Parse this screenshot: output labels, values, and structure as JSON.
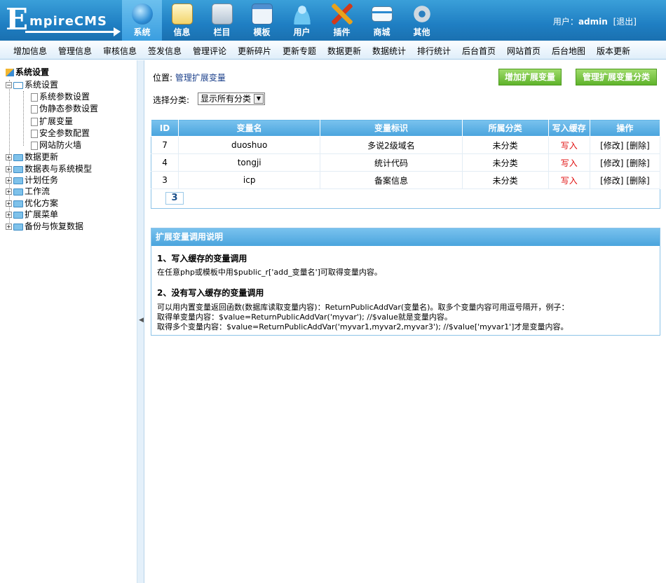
{
  "header": {
    "logo_letter": "E",
    "logo_rest": "mpireCMS",
    "nav": [
      {
        "label": "系统",
        "icon": "globe-icon"
      },
      {
        "label": "信息",
        "icon": "notepad-icon"
      },
      {
        "label": "栏目",
        "icon": "folder-icon"
      },
      {
        "label": "模板",
        "icon": "window-icon"
      },
      {
        "label": "用户",
        "icon": "user-icon"
      },
      {
        "label": "插件",
        "icon": "tools-icon"
      },
      {
        "label": "商城",
        "icon": "card-icon"
      },
      {
        "label": "其他",
        "icon": "gear-icon"
      }
    ],
    "user_label": "用户：",
    "user_name": "admin",
    "logout": "[退出]"
  },
  "menubar": [
    "增加信息",
    "管理信息",
    "审核信息",
    "签发信息",
    "管理评论",
    "更新碎片",
    "更新专题",
    "数据更新",
    "数据统计",
    "排行统计",
    "后台首页",
    "网站首页",
    "后台地图",
    "版本更新"
  ],
  "sidebar": {
    "root": "系统设置",
    "group": "系统设置",
    "children": [
      "系统参数设置",
      "伪静态参数设置",
      "扩展变量",
      "安全参数配置",
      "网站防火墙"
    ],
    "folders": [
      "数据更新",
      "数据表与系统模型",
      "计划任务",
      "工作流",
      "优化方案",
      "扩展菜单",
      "备份与恢复数据"
    ]
  },
  "main": {
    "location_label": "位置: ",
    "location_link": "管理扩展变量",
    "btn_add": "增加扩展变量",
    "btn_manage": "管理扩展变量分类",
    "filter_label": "选择分类:",
    "filter_value": "显示所有分类",
    "table": {
      "headers": [
        "ID",
        "变量名",
        "变量标识",
        "所属分类",
        "写入缓存",
        "操作"
      ],
      "rows": [
        {
          "id": "7",
          "name": "duoshuo",
          "label": "多说2级域名",
          "category": "未分类",
          "cache": "写入",
          "edit": "[修改]",
          "delete": "[删除]"
        },
        {
          "id": "4",
          "name": "tongji",
          "label": "统计代码",
          "category": "未分类",
          "cache": "写入",
          "edit": "[修改]",
          "delete": "[删除]"
        },
        {
          "id": "3",
          "name": "icp",
          "label": "备案信息",
          "category": "未分类",
          "cache": "写入",
          "edit": "[修改]",
          "delete": "[删除]"
        }
      ]
    },
    "pager": "3",
    "explain": {
      "title": "扩展变量调用说明",
      "s1_title": "1、写入缓存的变量调用",
      "s1_text": "在任意php或模板中用$public_r['add_变量名']可取得变量内容。",
      "s2_title": "2、没有写入缓存的变量调用",
      "s2_line1": "可以用内置变量返回函数(数据库读取变量内容)：ReturnPublicAddVar(变量名)。取多个变量内容可用逗号隔开，例子：",
      "s2_line2": "取得单变量内容：$value=ReturnPublicAddVar('myvar'); //$value就是变量内容。",
      "s2_line3": "取得多个变量内容：$value=ReturnPublicAddVar('myvar1,myvar2,myvar3'); //$value['myvar1']才是变量内容。"
    }
  }
}
